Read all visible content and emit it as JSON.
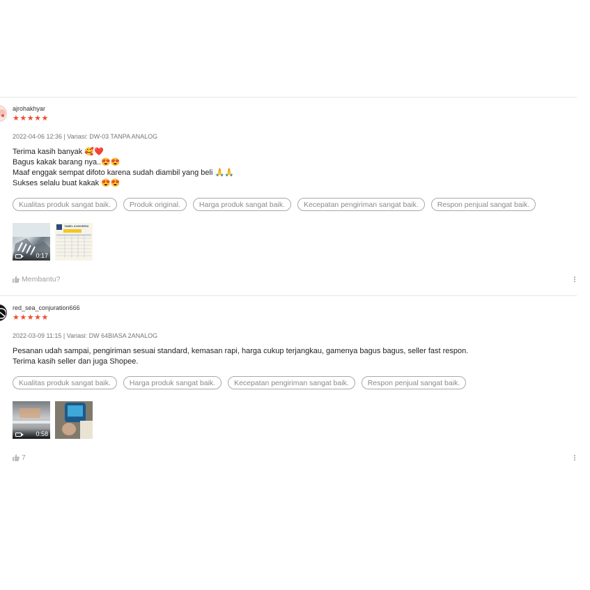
{
  "reviews": [
    {
      "username": "ajrohakhyar",
      "stars": "★★★★★",
      "meta": "2022-04-06 12:36 | Variasi: DW-03 TANPA ANALOG",
      "comment_lines": [
        "Terima kasih banyak 🥰❤️",
        "Bagus kakak barang nya..😍😍",
        "Maaf enggak sempat difoto karena sudah diambil yang beli 🙏🙏",
        "Sukses selalu buat kakak 😍😍"
      ],
      "tags": [
        "Kualitas produk sangat baik.",
        "Produk original.",
        "Harga produk sangat baik.",
        "Kecepatan pengiriman sangat baik.",
        "Respon penjual sangat baik."
      ],
      "video_duration": "0:17",
      "helpful_label": "Membantu?",
      "avatar_icon": "avatar-icon-pink",
      "table_header": "TABEL KONVERSI"
    },
    {
      "username": "red_sea_conjuration666",
      "stars": "★★★★★",
      "meta": "2022-03-09 11:15 | Variasi: DW 64BIASA 2ANALOG",
      "comment_lines": [
        "Pesanan udah sampai, pengiriman sesuai standard, kemasan rapi, harga cukup terjangkau, gamenya bagus bagus, seller fast respon.",
        "Terima kasih seller dan juga Shopee."
      ],
      "tags": [
        "Kualitas produk sangat baik.",
        "Harga produk sangat baik.",
        "Kecepatan pengiriman sangat baik.",
        "Respon penjual sangat baik."
      ],
      "video_duration": "0:58",
      "helpful_label": "7",
      "avatar_icon": "avatar-icon-black"
    }
  ],
  "colors": {
    "star": "#ee4d2d",
    "tag_border": "#a8a8a8",
    "muted": "#9e9e9e"
  }
}
